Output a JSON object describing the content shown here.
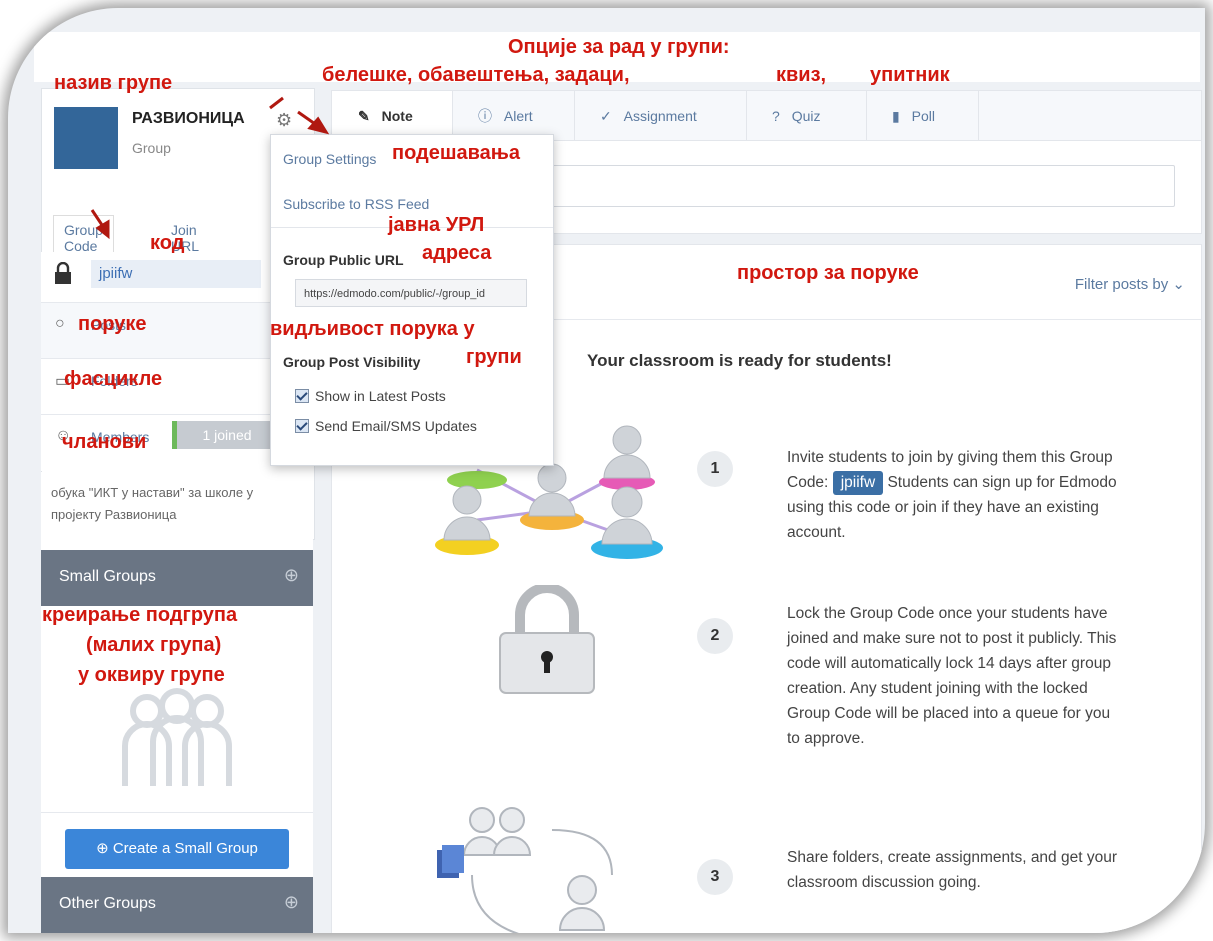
{
  "group": {
    "name": "РАЗВИОНИЦА",
    "type": "Group",
    "code_tabs": [
      "Group Code",
      "Join URL"
    ],
    "code": "jpiifw",
    "nav": {
      "posts": "Posts",
      "folders": "Folders",
      "members": "Members",
      "joined": "1 joined"
    },
    "description": "обука \"ИКТ у настави\" за школе у пројекту Развионица"
  },
  "small_groups": {
    "title": "Small Groups",
    "create_button": "Create a Small Group"
  },
  "other_groups": {
    "title": "Other Groups"
  },
  "post_tabs": [
    "Note",
    "Alert",
    "Assignment",
    "Quiz",
    "Poll"
  ],
  "dropdown": {
    "group_settings": "Group Settings",
    "rss": "Subscribe to RSS Feed",
    "public_url_label": "Group Public URL",
    "public_url_value": "https://edmodo.com/public/-/group_id",
    "visibility_label": "Group Post Visibility",
    "show_latest": "Show in Latest Posts",
    "send_updates": "Send Email/SMS Updates"
  },
  "feed": {
    "filter": "Filter posts by",
    "ready_title": "Your classroom is ready for students!",
    "steps": [
      {
        "num": "1",
        "before": "Invite students to join by giving them this Group Code:",
        "code": "jpiifw",
        "after": "Students can sign up for Edmodo using this code or join if they have an existing account."
      },
      {
        "num": "2",
        "text": "Lock the Group Code once your students have joined and make sure not to post it publicly. This code will automatically lock 14 days after group creation. Any student joining with the locked Group Code will be placed into a queue for you to approve."
      },
      {
        "num": "3",
        "text": "Share folders, create assignments, and get your classroom discussion going."
      }
    ]
  },
  "annotations": {
    "options_title": "Опције за рад у групи:",
    "options_list": "белешке, обавештења, задаци,",
    "quiz": "квиз,",
    "poll": "упитник",
    "group_name": "назив групе",
    "settings": "подешавања",
    "code": "код",
    "public_url_1": "јавна УРЛ",
    "public_url_2": "адреса",
    "messages_space": "простор за поруке",
    "visibility_1": "видљивост порука у",
    "visibility_2": "групи",
    "posts": "поруке",
    "folders": "фасцикле",
    "members": "чланови",
    "subgroups_1": "креирање подгрупа",
    "subgroups_2": "(малих група)",
    "subgroups_3": "у оквиру групе"
  }
}
